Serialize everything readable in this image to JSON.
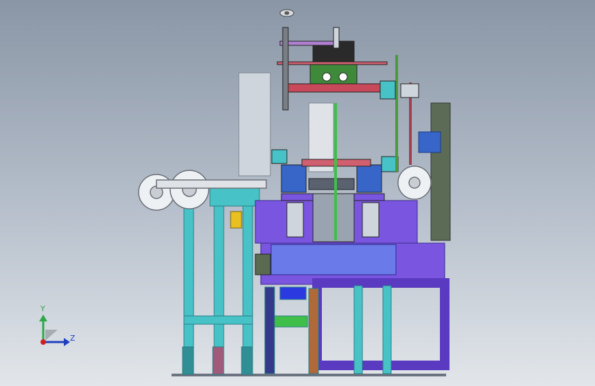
{
  "triad": {
    "y_label": "Y",
    "z_label": "Z",
    "colors": {
      "y": "#2ea84a",
      "z": "#1f3fbf",
      "x": "#d02020"
    }
  },
  "model": {
    "colors": {
      "frame_cyan": "#47c3c8",
      "table_purple": "#7a55e0",
      "gearbox_green": "#3f8a3a",
      "dark_olive": "#5b6b55",
      "motor_blue": "#3766c8",
      "rail_red": "#c84a5a",
      "housing_grey": "#cfd5dc"
    }
  }
}
